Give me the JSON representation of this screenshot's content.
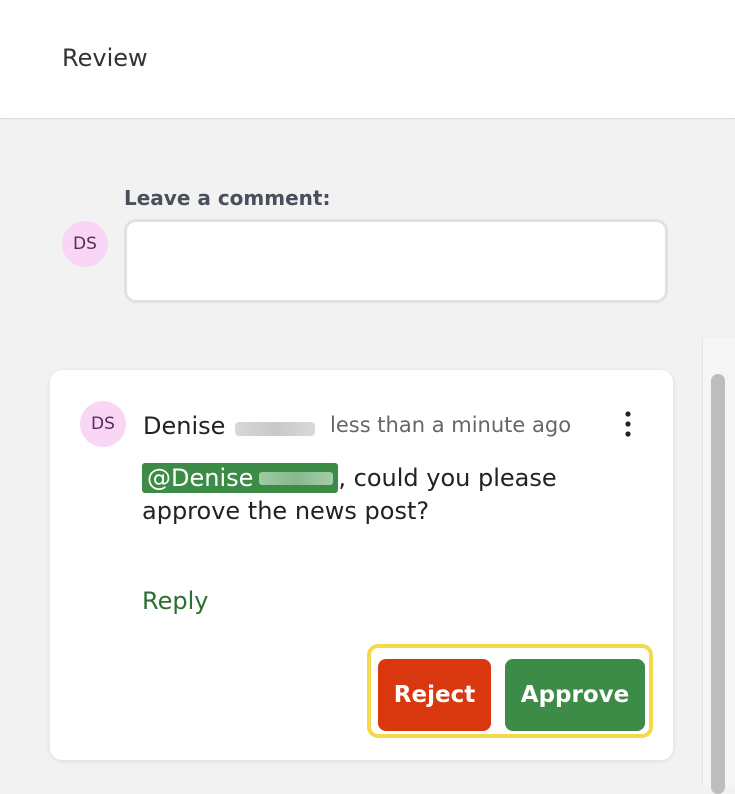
{
  "header": {
    "title": "Review"
  },
  "new_comment": {
    "label": "Leave a comment:",
    "avatar_initials": "DS",
    "input_value": "",
    "input_placeholder": ""
  },
  "comment": {
    "avatar_initials": "DS",
    "author_first_name": "Denise",
    "timestamp": "less than a minute ago",
    "mention_text": "@Denise",
    "body_text": ", could you please approve the news post?",
    "reply_label": "Reply",
    "more_icon": "vertical-ellipsis-icon",
    "actions": {
      "reject_label": "Reject",
      "approve_label": "Approve"
    }
  },
  "colors": {
    "avatar_bg": "#f9d6f5",
    "mention_bg": "#3c8b46",
    "reject": "#d9380f",
    "approve": "#3c8b46",
    "reply_link": "#2d6e35",
    "focus_highlight": "#f5d94b"
  }
}
